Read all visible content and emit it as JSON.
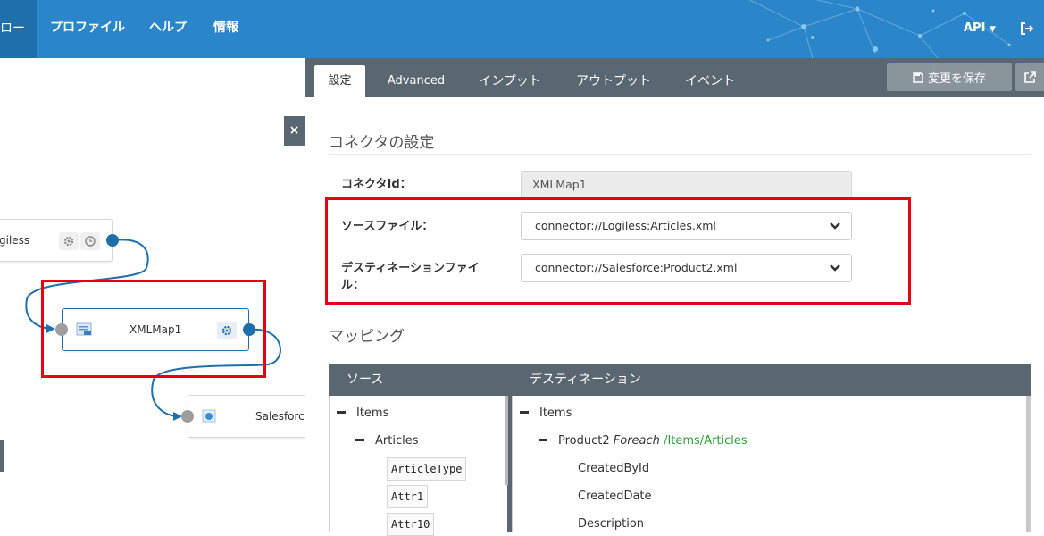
{
  "nav": {
    "active_partial": "ロー",
    "items": [
      "プロファイル",
      "ヘルプ",
      "情報"
    ],
    "api_label": "API",
    "colors": {
      "bar": "#2b86c9",
      "active": "#1f6faa"
    }
  },
  "canvas": {
    "nodes": [
      {
        "label": "giless"
      },
      {
        "label": "XMLMap1"
      },
      {
        "label": "Salesforce"
      }
    ],
    "close_label": "×"
  },
  "panel": {
    "tabs": [
      "設定",
      "Advanced",
      "インプット",
      "アウトプット",
      "イベント"
    ],
    "save_label": "変更を保存",
    "connector_section": "コネクタの設定",
    "fields": {
      "connector_id_label": "コネクタId：",
      "connector_id_value": "XMLMap1",
      "source_label": "ソースファイル：",
      "source_value": "connector://Logiless:Articles.xml",
      "dest_label_line1": "デスティネーションファイ",
      "dest_label_line2": "ル：",
      "dest_value": "connector://Salesforce:Product2.xml"
    },
    "mapping_section": "マッピング",
    "mapping": {
      "source_header": "ソース",
      "dest_header": "デスティネーション",
      "source_tree": {
        "root": "Items",
        "child": "Articles",
        "leaves": [
          "ArticleType",
          "Attr1",
          "Attr10"
        ]
      },
      "dest_tree": {
        "root": "Items",
        "child": "Product2",
        "foreach": "Foreach",
        "xpath": "/Items/Articles",
        "leaves": [
          "CreatedById",
          "CreatedDate",
          "Description"
        ]
      }
    }
  }
}
